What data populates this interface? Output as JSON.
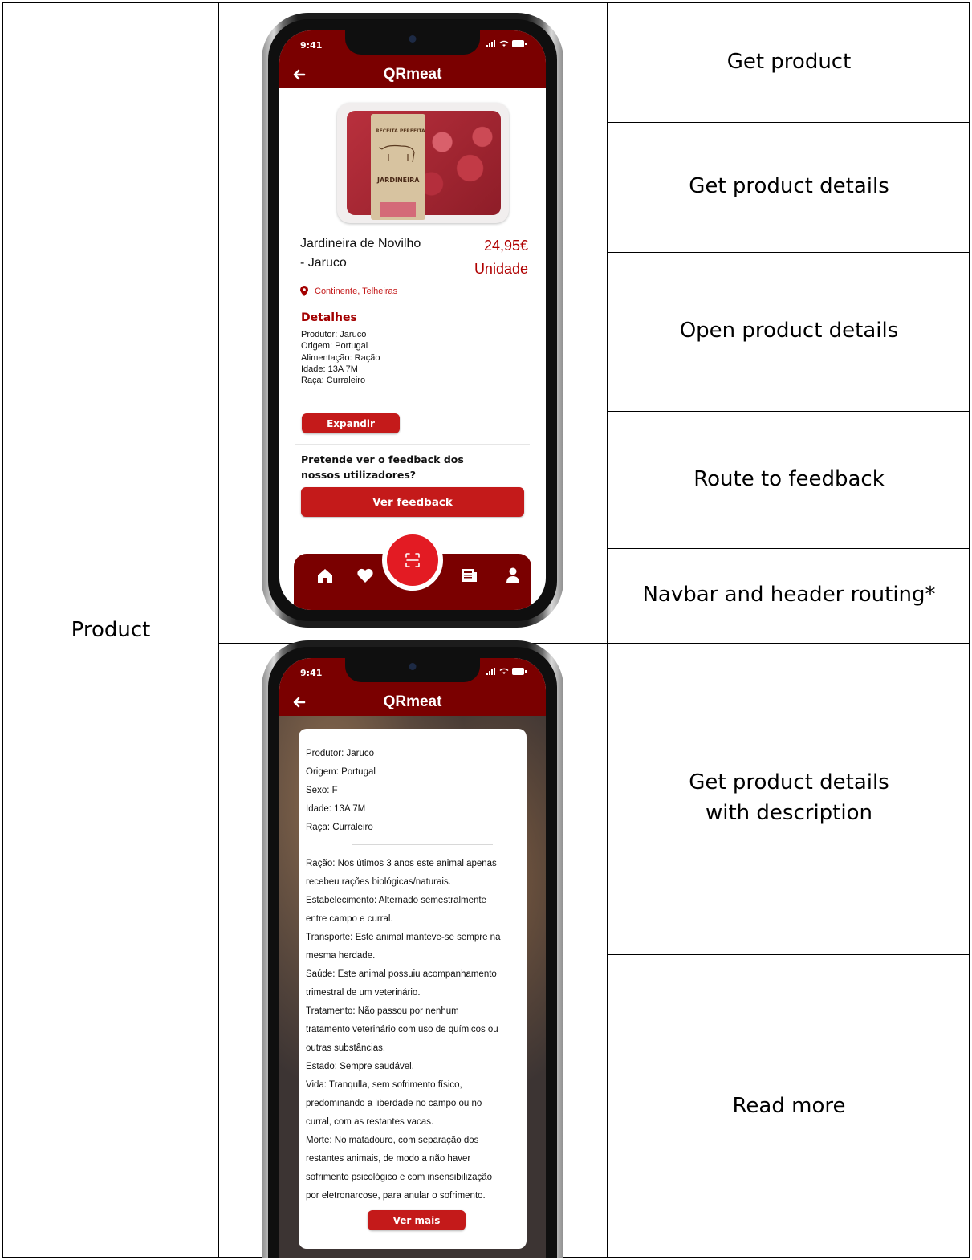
{
  "table": {
    "feature": "Product",
    "rows_top": [
      "Get product",
      "Get product details",
      "Open product details",
      "Route to feedback",
      "Navbar and header routing*"
    ],
    "rows_bottom": [
      "Get product details with description",
      "Read more"
    ]
  },
  "phone": {
    "time": "9:41",
    "app_title": "QRmeat"
  },
  "product": {
    "name_line1": "Jardineira de Novilho",
    "name_line2": "- Jaruco",
    "price": "24,95€",
    "unit": "Unidade",
    "location": "Continente, Telheiras",
    "details_title": "Detalhes",
    "details": [
      "Produtor: Jaruco",
      "Origem: Portugal",
      "Alimentação: Ração",
      "Idade: 13A 7M",
      "Raça: Curraleiro"
    ],
    "expand_label": "Expandir",
    "feedback_q1": "Pretende ver o feedback dos",
    "feedback_q2": "nossos utilizadores?",
    "feedback_btn": "Ver feedback",
    "package_title": "RECEITA PERFEITA",
    "package_name": "JARDINEIRA"
  },
  "details_modal": {
    "basic": [
      "Produtor: Jaruco",
      "Origem: Portugal",
      "Sexo: F",
      "Idade: 13A 7M",
      "Raça: Curraleiro"
    ],
    "description": [
      "Ração: Nos útimos 3 anos este animal apenas",
      "recebeu rações biológicas/naturais.",
      "Estabelecimento: Alternado semestralmente",
      "entre campo e curral.",
      "Transporte: Este animal manteve-se sempre na",
      "mesma herdade.",
      "Saúde: Este animal possuiu acompanhamento",
      "trimestral de um veterinário.",
      "Tratamento: Não passou por nenhum",
      "tratamento veterinário com uso de químicos ou",
      "outras substâncias.",
      "Estado: Sempre saudável.",
      "Vida: Tranqulla, sem sofrimento físico,",
      "predominando a liberdade no campo ou no",
      "curral, com as restantes vacas.",
      "Morte: No matadouro, com separação dos",
      "restantes animais, de modo a não haver",
      "sofrimento psicológico e com insensibilização",
      "por eletronarcose, para anular o sofrimento."
    ],
    "more_label": "Ver mais"
  },
  "colors": {
    "brand_dark": "#7a0000",
    "brand_red": "#c41a1a",
    "scan_red": "#e31b23"
  }
}
